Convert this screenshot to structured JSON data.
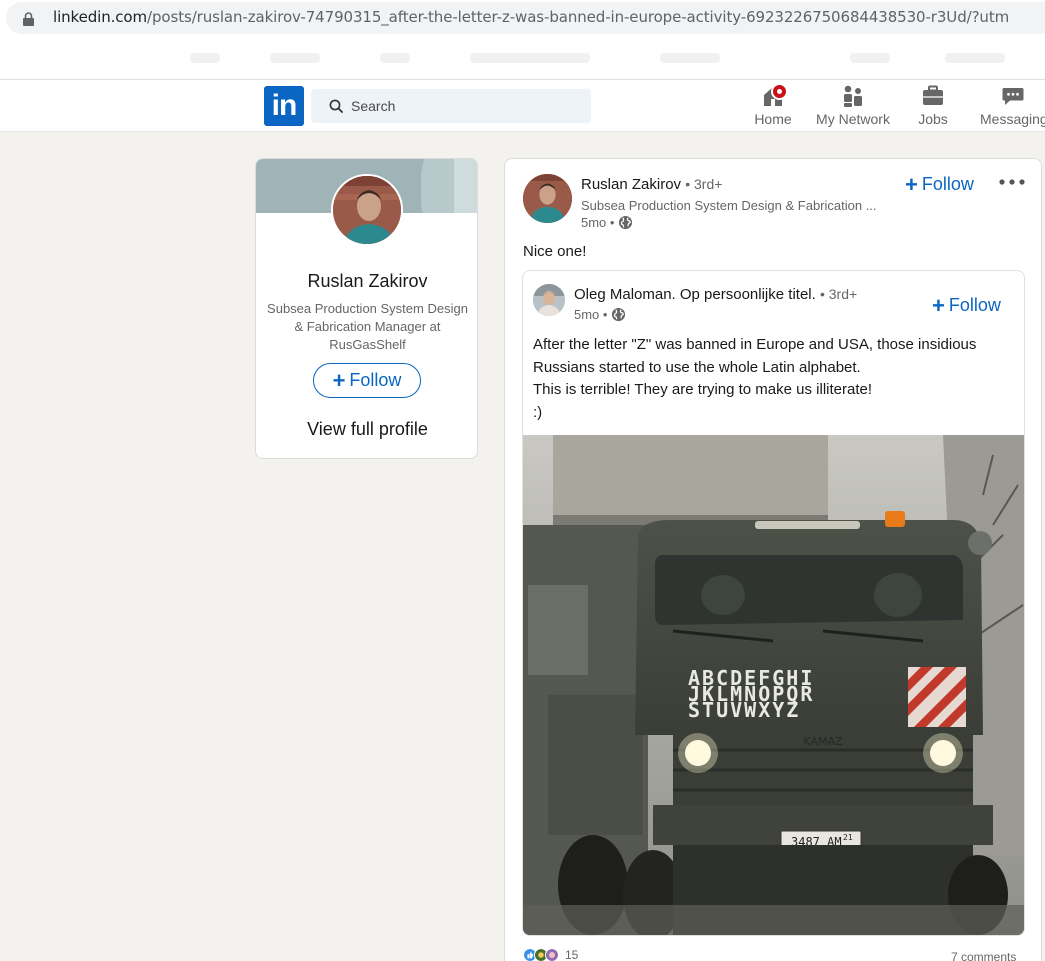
{
  "browser": {
    "url_domain": "linkedin.com",
    "url_path": "/posts/ruslan-zakirov-74790315_after-the-letter-z-was-banned-in-europe-activity-6923226750684438530-r3Ud/?utm"
  },
  "nav": {
    "logo_text": "in",
    "search_placeholder": "Search",
    "items": [
      {
        "label": "Home",
        "icon": "home-icon"
      },
      {
        "label": "My Network",
        "icon": "network-icon"
      },
      {
        "label": "Jobs",
        "icon": "briefcase-icon"
      },
      {
        "label": "Messaging",
        "icon": "messaging-icon"
      }
    ]
  },
  "profile": {
    "name": "Ruslan Zakirov",
    "headline": "Subsea Production System Design & Fabrication Manager at RusGasShelf",
    "follow_label": "Follow",
    "view_profile_label": "View full profile"
  },
  "post": {
    "author_name": "Ruslan Zakirov",
    "degree": "• 3rd+",
    "author_headline": "Subsea Production System Design & Fabrication ...",
    "time": "5mo •",
    "follow_label": "Follow",
    "text": "Nice one!",
    "reshare": {
      "author_name": "Oleg Maloman. Op persoonlijke titel.",
      "degree": "• 3rd+",
      "time": "5mo •",
      "follow_label": "Follow",
      "lines": [
        "After the letter \"Z\" was banned in Europe and USA, those insidious Russians started to use the whole Latin alphabet.",
        "This is terrible! They are trying to make us illiterate!",
        ":)"
      ],
      "image": {
        "truck_text_line1": "ABCDEFGHI",
        "truck_text_line2": "JKLMNOPQR",
        "truck_text_line3": "STUVWXYZ",
        "plate": "3487 AM",
        "plate_region": "21",
        "grille_brand": "KAMAZ"
      }
    },
    "reaction_count": "15",
    "comments": "7 comments"
  },
  "colors": {
    "brand": "#0a66c2",
    "page_bg": "#f3f2ef",
    "notification": "#cc1016"
  }
}
